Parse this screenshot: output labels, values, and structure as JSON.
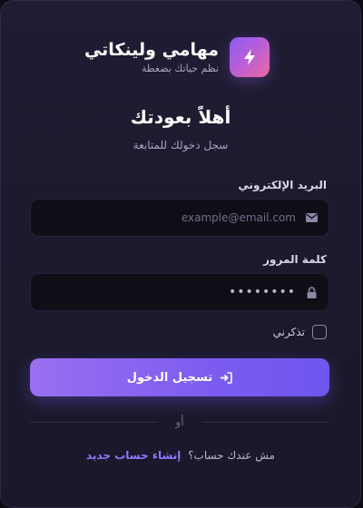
{
  "brand": {
    "name": "مهامي ولينكاتي",
    "tagline": "نظم حياتك بضغطة",
    "logo_icon": "lightning-bolt-icon"
  },
  "login": {
    "title": "أهلاً بعودتك",
    "subtitle": "سجل دخولك للمتابعة",
    "email": {
      "label": "البريد الإلكتروني",
      "placeholder": "example@email.com",
      "icon": "envelope-icon"
    },
    "password": {
      "label": "كلمة المرور",
      "value": "••••••••",
      "icon": "lock-icon"
    },
    "remember_label": "تذكرني",
    "submit_label": "تسجيل الدخول",
    "submit_icon": "sign-in-icon",
    "divider_text": "أو",
    "signup_prompt": "مش عندك حساب؟",
    "signup_link": "إنشاء حساب جديد"
  },
  "colors": {
    "accent": "#7c5cf0",
    "link": "#8b7bff",
    "logo_gradient_start": "#8b5cf6",
    "logo_gradient_end": "#ec6aa0"
  }
}
